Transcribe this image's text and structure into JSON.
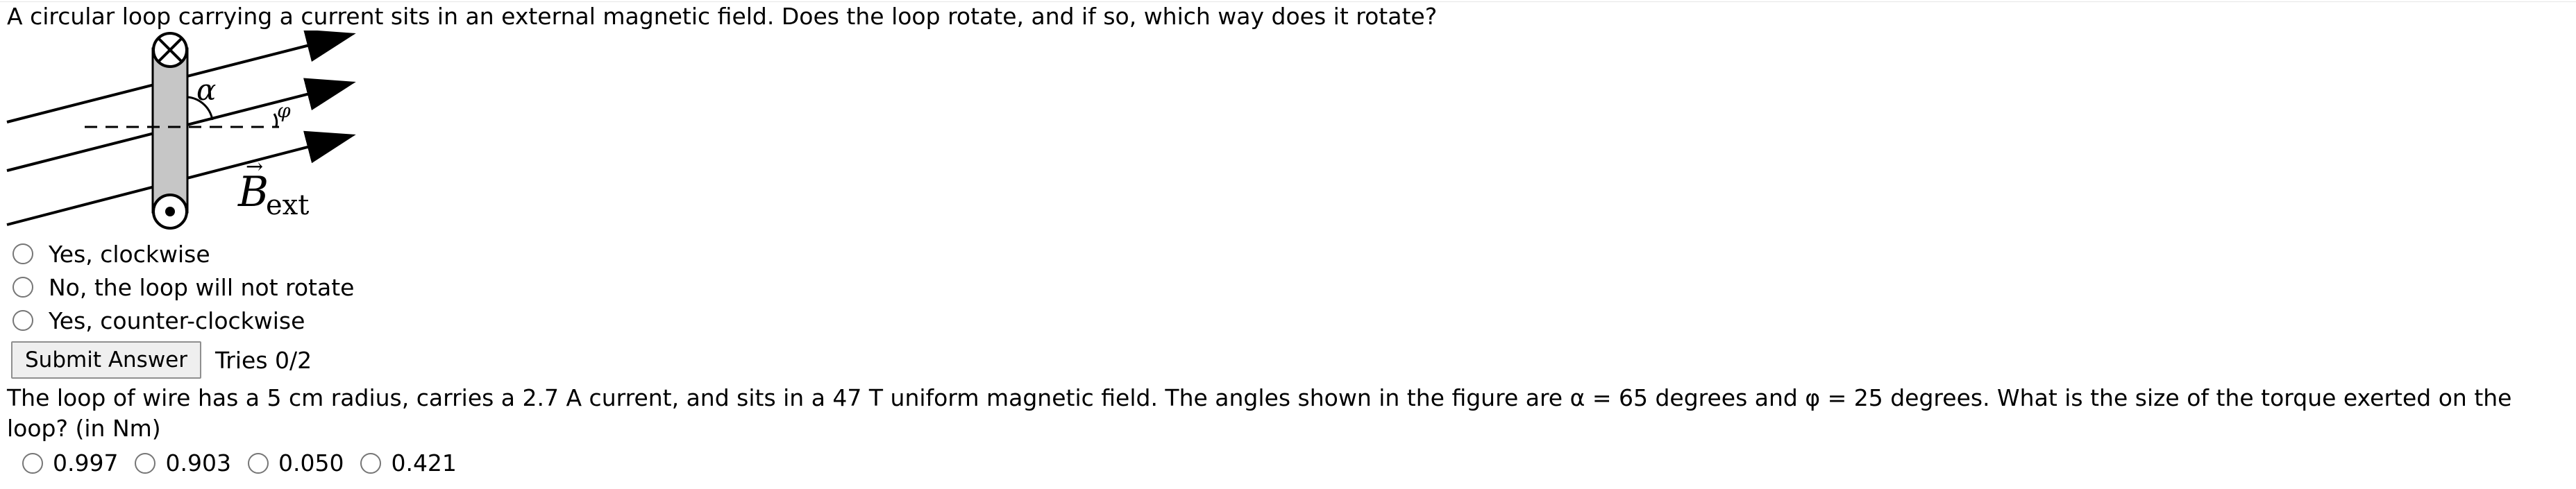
{
  "question1": {
    "prompt": "A circular loop carrying a current sits in an external magnetic field. Does the loop rotate, and if so, which way does it rotate?"
  },
  "figure": {
    "alpha_label": "α",
    "phi_label": "φ",
    "b_label_main": "B",
    "b_label_subscript": "ext"
  },
  "choices": [
    {
      "label": "Yes, clockwise"
    },
    {
      "label": "No, the loop will not rotate"
    },
    {
      "label": "Yes, counter-clockwise"
    }
  ],
  "submit": {
    "label": "Submit Answer",
    "tries": "Tries 0/2"
  },
  "question2": {
    "prompt": "The loop of wire has a 5 cm radius, carries a 2.7 A current, and sits in a 47 T uniform magnetic field. The angles shown in the figure are α = 65 degrees and φ = 25 degrees. What is the size of the torque exerted on the loop? (in Nm)"
  },
  "answers": [
    {
      "label": "0.997"
    },
    {
      "label": "0.903"
    },
    {
      "label": "0.050"
    },
    {
      "label": "0.421"
    }
  ]
}
